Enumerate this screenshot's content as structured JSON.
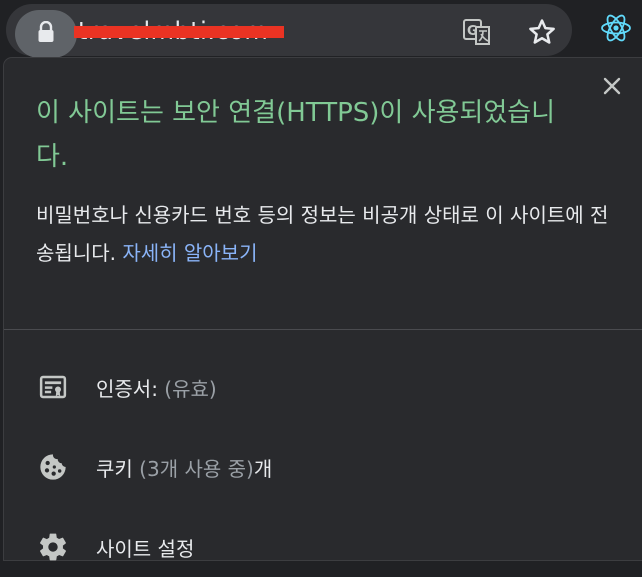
{
  "toolbar": {
    "url_text": "travelmbti.com"
  },
  "popup": {
    "title": "이 사이트는 보안 연결(HTTPS)이 사용되었습니다.",
    "description": "비밀번호나 신용카드 번호 등의 정보는 비공개 상태로 이 사이트에 전송됩니다. ",
    "learn_more": "자세히 알아보기",
    "items": [
      {
        "label": "인증서:",
        "sub": " (유효)",
        "suffix": "",
        "icon": "certificate-icon"
      },
      {
        "label": "쿠키",
        "sub": " (3개 사용 중)",
        "suffix": "개",
        "icon": "cookie-icon"
      },
      {
        "label": "사이트 설정",
        "sub": "",
        "suffix": "",
        "icon": "gear-icon"
      }
    ]
  },
  "colors": {
    "secure_title": "#81c995",
    "link": "#8ab4f8",
    "background": "#292a2d",
    "redaction": "#ea3323"
  }
}
